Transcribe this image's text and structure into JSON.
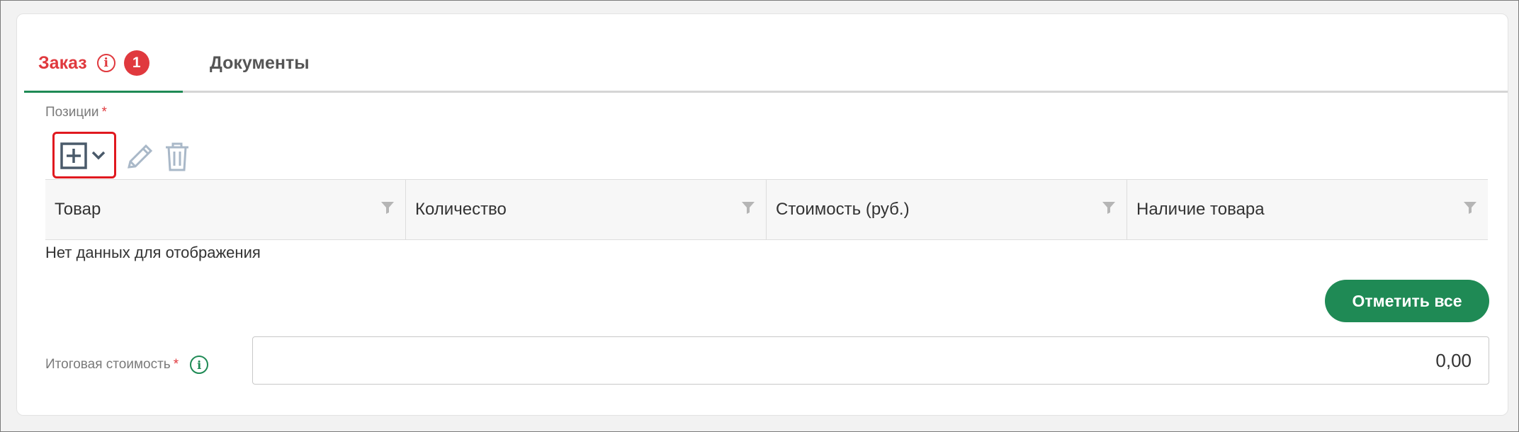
{
  "tabs": [
    {
      "label": "Заказ",
      "error_count": "1",
      "info_symbol": "i"
    },
    {
      "label": "Документы"
    }
  ],
  "positions": {
    "label": "Позиции",
    "required_mark": "*"
  },
  "toolbar": {
    "add_icon": "add-box-icon",
    "add_dropdown_icon": "chevron-down-icon",
    "edit_icon": "pencil-icon",
    "delete_icon": "trash-icon"
  },
  "table": {
    "columns": [
      "Товар",
      "Количество",
      "Стоимость (руб.)",
      "Наличие товара"
    ],
    "empty_text": "Нет данных для отображения"
  },
  "actions": {
    "mark_all_label": "Отметить все"
  },
  "total": {
    "label": "Итоговая стоимость",
    "required_mark": "*",
    "info_symbol": "i",
    "value": "0,00"
  },
  "colors": {
    "accent_green": "#1f8a55",
    "error_red": "#e0393e",
    "highlight_red": "#e0191f"
  }
}
